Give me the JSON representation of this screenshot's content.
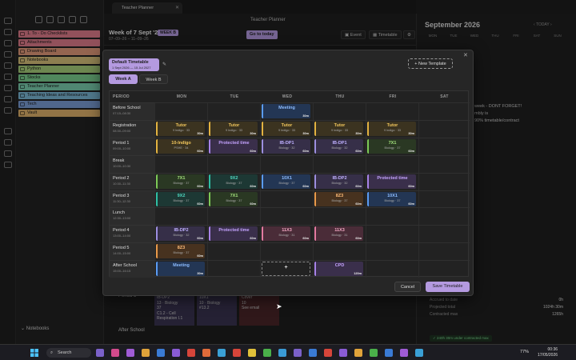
{
  "app": {
    "tab_title": "Teacher Planner",
    "doc_title": "Teacher Planner"
  },
  "sidebar": {
    "folders": [
      {
        "label": "1. To - Do Checklists",
        "color": "#e07d8c"
      },
      {
        "label": "Attachments",
        "color": "#e07d8c"
      },
      {
        "label": "Drawing Board",
        "color": "#e49b7c"
      },
      {
        "label": "Notebooks",
        "color": "#d9c27c"
      },
      {
        "label": "Python",
        "color": "#a8d07c"
      },
      {
        "label": "Stocks",
        "color": "#7ccf8f"
      },
      {
        "label": "Teacher Planner",
        "color": "#7ccfb0"
      },
      {
        "label": "Teaching Ideas and Resources",
        "color": "#7cb8d8"
      },
      {
        "label": "Tech",
        "color": "#7c9fd8"
      },
      {
        "label": "Vault",
        "color": "#e0b36c"
      }
    ],
    "vault_name": "Notebooks"
  },
  "header": {
    "week_title": "Week of 7 Sept '26",
    "week_badge": "WEEK B",
    "week_range": "07–09–26 – 11–09–26",
    "today_button": "Go to today",
    "event_button": "Event",
    "timetable_button": "Timetable"
  },
  "background": {
    "period_label": "Period 5",
    "after_school_label": "After School",
    "cards": [
      {
        "line1": "IB-DP2",
        "line2": "13 · Biology",
        "line3": "37",
        "line4": "C1.2 - Cell",
        "line5": "Respiration I.1"
      },
      {
        "line1": "10X1",
        "line2": "10 · Biology",
        "line3": "#13.2",
        "line4": "",
        "line5": ""
      },
      {
        "line1": "Cover",
        "line2": "10",
        "line3": "See email",
        "line4": "",
        "line5": ""
      }
    ]
  },
  "right_pane": {
    "month_title": "September 2026",
    "today_nav": "‹  TODAY  ›",
    "weekdays": [
      "MON",
      "TUE",
      "WED",
      "THU",
      "FRI",
      "SAT",
      "SUN"
    ],
    "notes": [
      "week - DONT FORGET!",
      "mbly is",
      "90% timetable/contract"
    ],
    "stats": [
      {
        "label": "Accrued to date",
        "value": "0h"
      },
      {
        "label": "Projected total",
        "value": "1024h 30m"
      },
      {
        "label": "Contracted max",
        "value": "1265h"
      }
    ],
    "status": "✓  240h 30m under contracted max"
  },
  "modal": {
    "template_name": "Default Timetable",
    "template_dates": "1 Sept 2026 — 15 Jul 2027",
    "new_template": "+ New Template",
    "tabs": [
      "Week A",
      "Week B"
    ],
    "columns": [
      "PERIOD",
      "MON",
      "TUE",
      "WED",
      "THU",
      "FRI",
      "SAT"
    ],
    "rows": [
      {
        "name": "Before School",
        "time": "07:15–08:30"
      },
      {
        "name": "Registration",
        "time": "08:30–09:00"
      },
      {
        "name": "Period 1",
        "time": "09:00–10:00"
      },
      {
        "name": "Break",
        "time": "10:00–10:30"
      },
      {
        "name": "Period 2",
        "time": "10:30–11:30"
      },
      {
        "name": "Period 3",
        "time": "11:30–12:30"
      },
      {
        "name": "Lunch",
        "time": "12:30–13:00"
      },
      {
        "name": "Period 4",
        "time": "13:00–14:00"
      },
      {
        "name": "Period 5",
        "time": "14:00–15:00"
      },
      {
        "name": "After School",
        "time": "15:00–16:15"
      }
    ],
    "cells": [
      {
        "row": 0,
        "col": 2,
        "title": "Meeting",
        "sub": "",
        "dur": "30m",
        "kind": "meet"
      },
      {
        "row": 1,
        "col": 0,
        "title": "Tutor",
        "sub": "9 Indigo · 33",
        "dur": "30m",
        "kind": "tutor"
      },
      {
        "row": 1,
        "col": 1,
        "title": "Tutor",
        "sub": "9 Indigo · 33",
        "dur": "30m",
        "kind": "tutor"
      },
      {
        "row": 1,
        "col": 2,
        "title": "Tutor",
        "sub": "9 Indigo · 33",
        "dur": "30m",
        "kind": "tutor"
      },
      {
        "row": 1,
        "col": 3,
        "title": "Tutor",
        "sub": "9 Indigo · 33",
        "dur": "30m",
        "kind": "tutor"
      },
      {
        "row": 1,
        "col": 4,
        "title": "Tutor",
        "sub": "9 Indigo · 33",
        "dur": "30m",
        "kind": "tutor"
      },
      {
        "row": 2,
        "col": 0,
        "title": "10-Indigo",
        "sub": "PSHE · 34",
        "dur": "60m",
        "kind": "tutor"
      },
      {
        "row": 2,
        "col": 1,
        "title": "Protected time",
        "sub": "",
        "dur": "60m",
        "kind": "prot"
      },
      {
        "row": 2,
        "col": 2,
        "title": "IB-DP1",
        "sub": "Biology · 32",
        "dur": "60m",
        "kind": "lav"
      },
      {
        "row": 2,
        "col": 3,
        "title": "IB-DP1",
        "sub": "Biology · 32",
        "dur": "60m",
        "kind": "lav"
      },
      {
        "row": 2,
        "col": 4,
        "title": "7X1",
        "sub": "Biology · 37",
        "dur": "60m",
        "kind": "green"
      },
      {
        "row": 4,
        "col": 0,
        "title": "7X1",
        "sub": "Biology · 37",
        "dur": "60m",
        "kind": "green"
      },
      {
        "row": 4,
        "col": 1,
        "title": "9X2",
        "sub": "Biology · 37",
        "dur": "60m",
        "kind": "teal"
      },
      {
        "row": 4,
        "col": 2,
        "title": "10X1",
        "sub": "Biology · 37",
        "dur": "60m",
        "kind": "meet"
      },
      {
        "row": 4,
        "col": 3,
        "title": "IB-DP2",
        "sub": "Biology · 32",
        "dur": "60m",
        "kind": "lav"
      },
      {
        "row": 4,
        "col": 4,
        "title": "Protected time",
        "sub": "",
        "dur": "60m",
        "kind": "prot"
      },
      {
        "row": 5,
        "col": 0,
        "title": "9X2",
        "sub": "Biology · 37",
        "dur": "60m",
        "kind": "teal"
      },
      {
        "row": 5,
        "col": 1,
        "title": "7X1",
        "sub": "Biology · 37",
        "dur": "60m",
        "kind": "green"
      },
      {
        "row": 5,
        "col": 3,
        "title": "8Z3",
        "sub": "Biology · 37",
        "dur": "60m",
        "kind": "orange"
      },
      {
        "row": 5,
        "col": 4,
        "title": "10X1",
        "sub": "Biology · 37",
        "dur": "60m",
        "kind": "meet"
      },
      {
        "row": 7,
        "col": 0,
        "title": "IB-DP2",
        "sub": "Biology · 32",
        "dur": "60m",
        "kind": "lav"
      },
      {
        "row": 7,
        "col": 1,
        "title": "Protected time",
        "sub": "",
        "dur": "60m",
        "kind": "prot"
      },
      {
        "row": 7,
        "col": 2,
        "title": "11X3",
        "sub": "Biology · 31",
        "dur": "60m",
        "kind": "pink"
      },
      {
        "row": 7,
        "col": 3,
        "title": "11X3",
        "sub": "Biology · 31",
        "dur": "60m",
        "kind": "pink"
      },
      {
        "row": 8,
        "col": 0,
        "title": "8Z3",
        "sub": "Biology · 37",
        "dur": "60m",
        "kind": "orange"
      },
      {
        "row": 9,
        "col": 0,
        "title": "Meeting",
        "sub": "",
        "dur": "30m",
        "kind": "meet"
      },
      {
        "row": 9,
        "col": 2,
        "title": "+",
        "sub": "",
        "dur": "",
        "kind": "add"
      },
      {
        "row": 9,
        "col": 3,
        "title": "CPD",
        "sub": "",
        "dur": "120m",
        "kind": "prot"
      }
    ],
    "cancel": "Cancel",
    "save": "Save Timetable"
  },
  "taskbar": {
    "search_placeholder": "Search",
    "battery": "77%",
    "time": "00:36",
    "date": "17/05/2026"
  }
}
